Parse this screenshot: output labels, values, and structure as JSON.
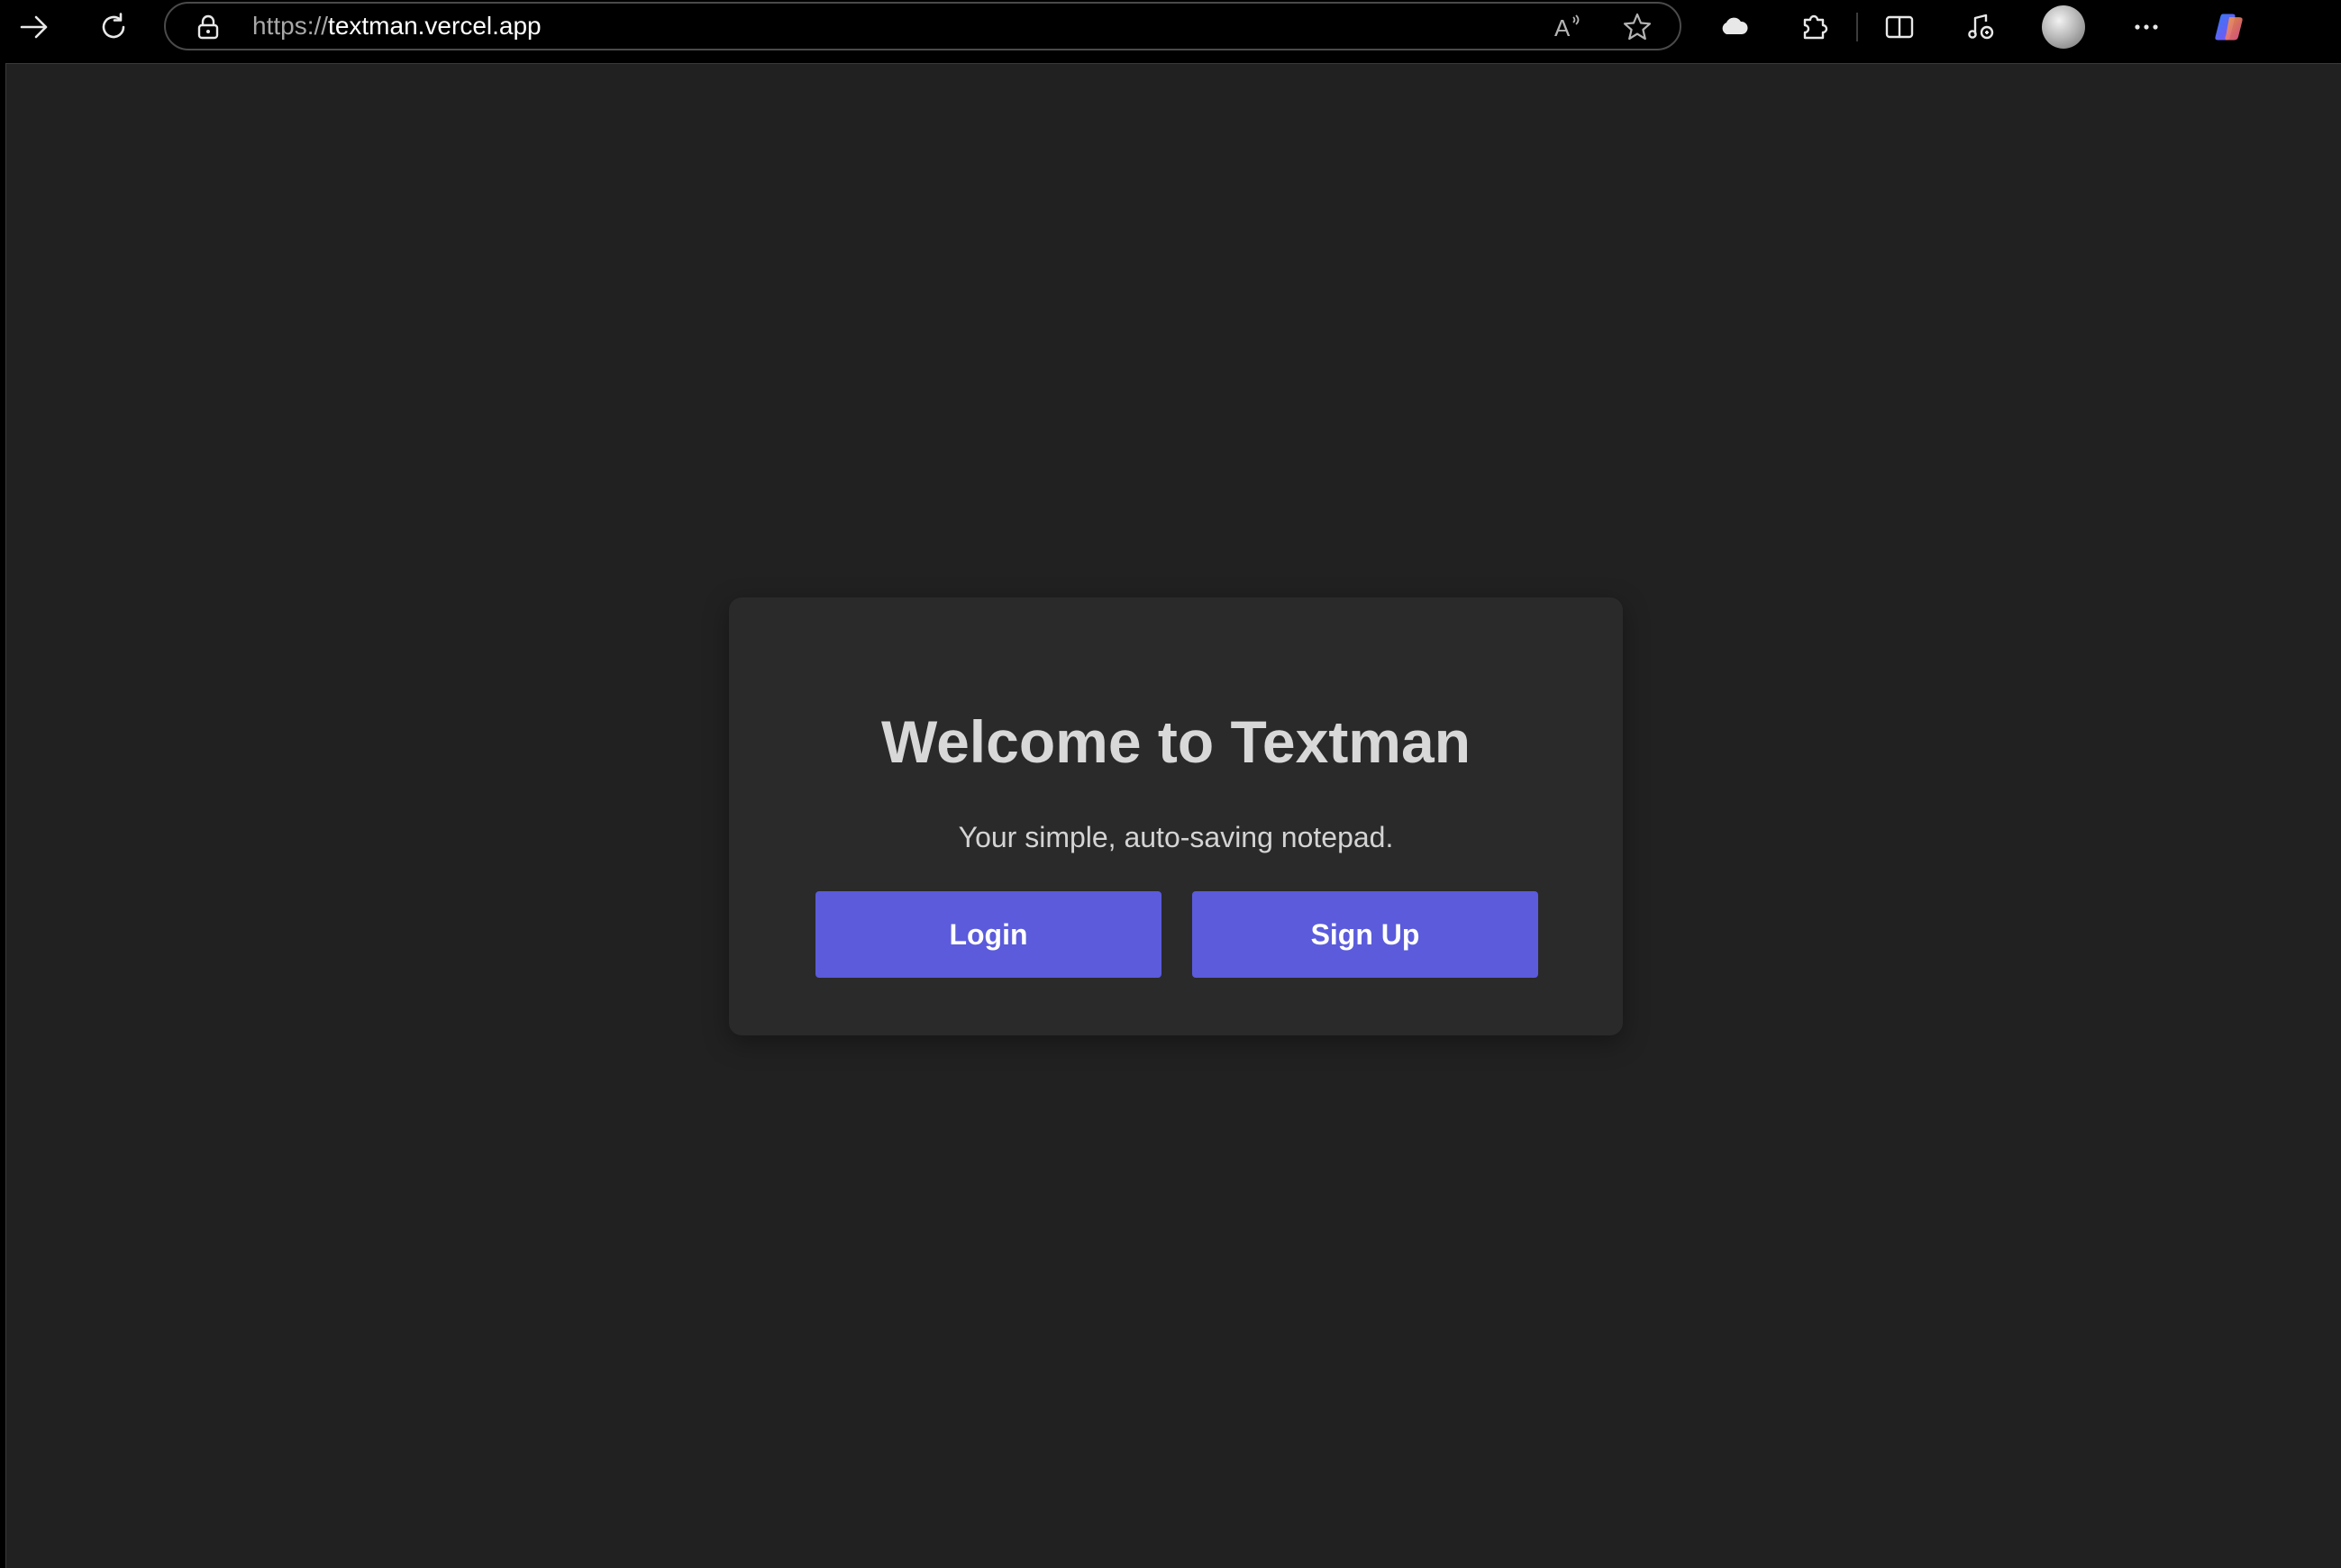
{
  "browser": {
    "url_scheme": "https://",
    "url_host": "textman.vercel.app",
    "icons": {
      "forward": "arrow-right-icon",
      "reload": "reload-icon",
      "lock": "lock-icon",
      "read_aloud": "read-aloud-icon",
      "favorite": "star-icon",
      "cloud": "cloud-icon",
      "extensions": "puzzle-icon",
      "split_screen": "split-screen-icon",
      "media": "music-note-icon",
      "profile": "avatar",
      "more": "more-dots-icon",
      "copilot": "copilot-icon"
    },
    "read_aloud_label": "A"
  },
  "page": {
    "title": "Welcome to Textman",
    "subtitle": "Your simple, auto-saving notepad.",
    "login_label": "Login",
    "signup_label": "Sign Up"
  },
  "colors": {
    "page_background": "#212121",
    "card_background": "#2a2a2a",
    "button_accent": "#5b5bdc",
    "title_text": "#d8d8d8"
  }
}
